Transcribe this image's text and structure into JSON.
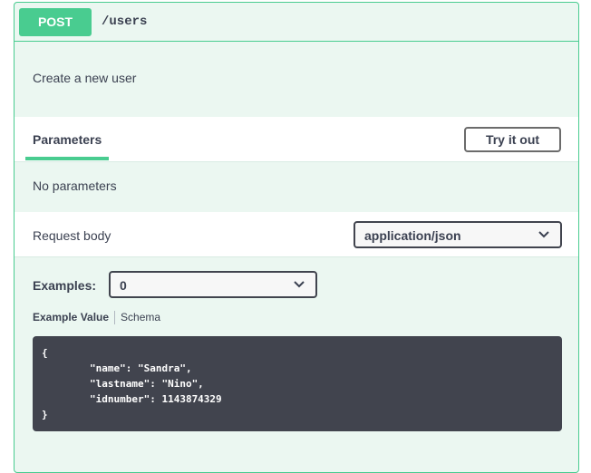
{
  "operation": {
    "method": "POST",
    "path": "/users",
    "description": "Create a new user"
  },
  "parameters": {
    "tab_label": "Parameters",
    "try_button": "Try it out",
    "empty_text": "No parameters"
  },
  "request_body": {
    "label": "Request body",
    "content_type": "application/json"
  },
  "examples": {
    "label": "Examples:",
    "selected": "0",
    "tabs": [
      "Example Value",
      "Schema"
    ],
    "code": "{\n        \"name\": \"Sandra\",\n        \"lastname\": \"Nino\",\n        \"idnumber\": 1143874329\n}"
  },
  "colors": {
    "accent": "#49cc90",
    "panel_bg": "#ebf7f1",
    "code_bg": "#41444e"
  }
}
